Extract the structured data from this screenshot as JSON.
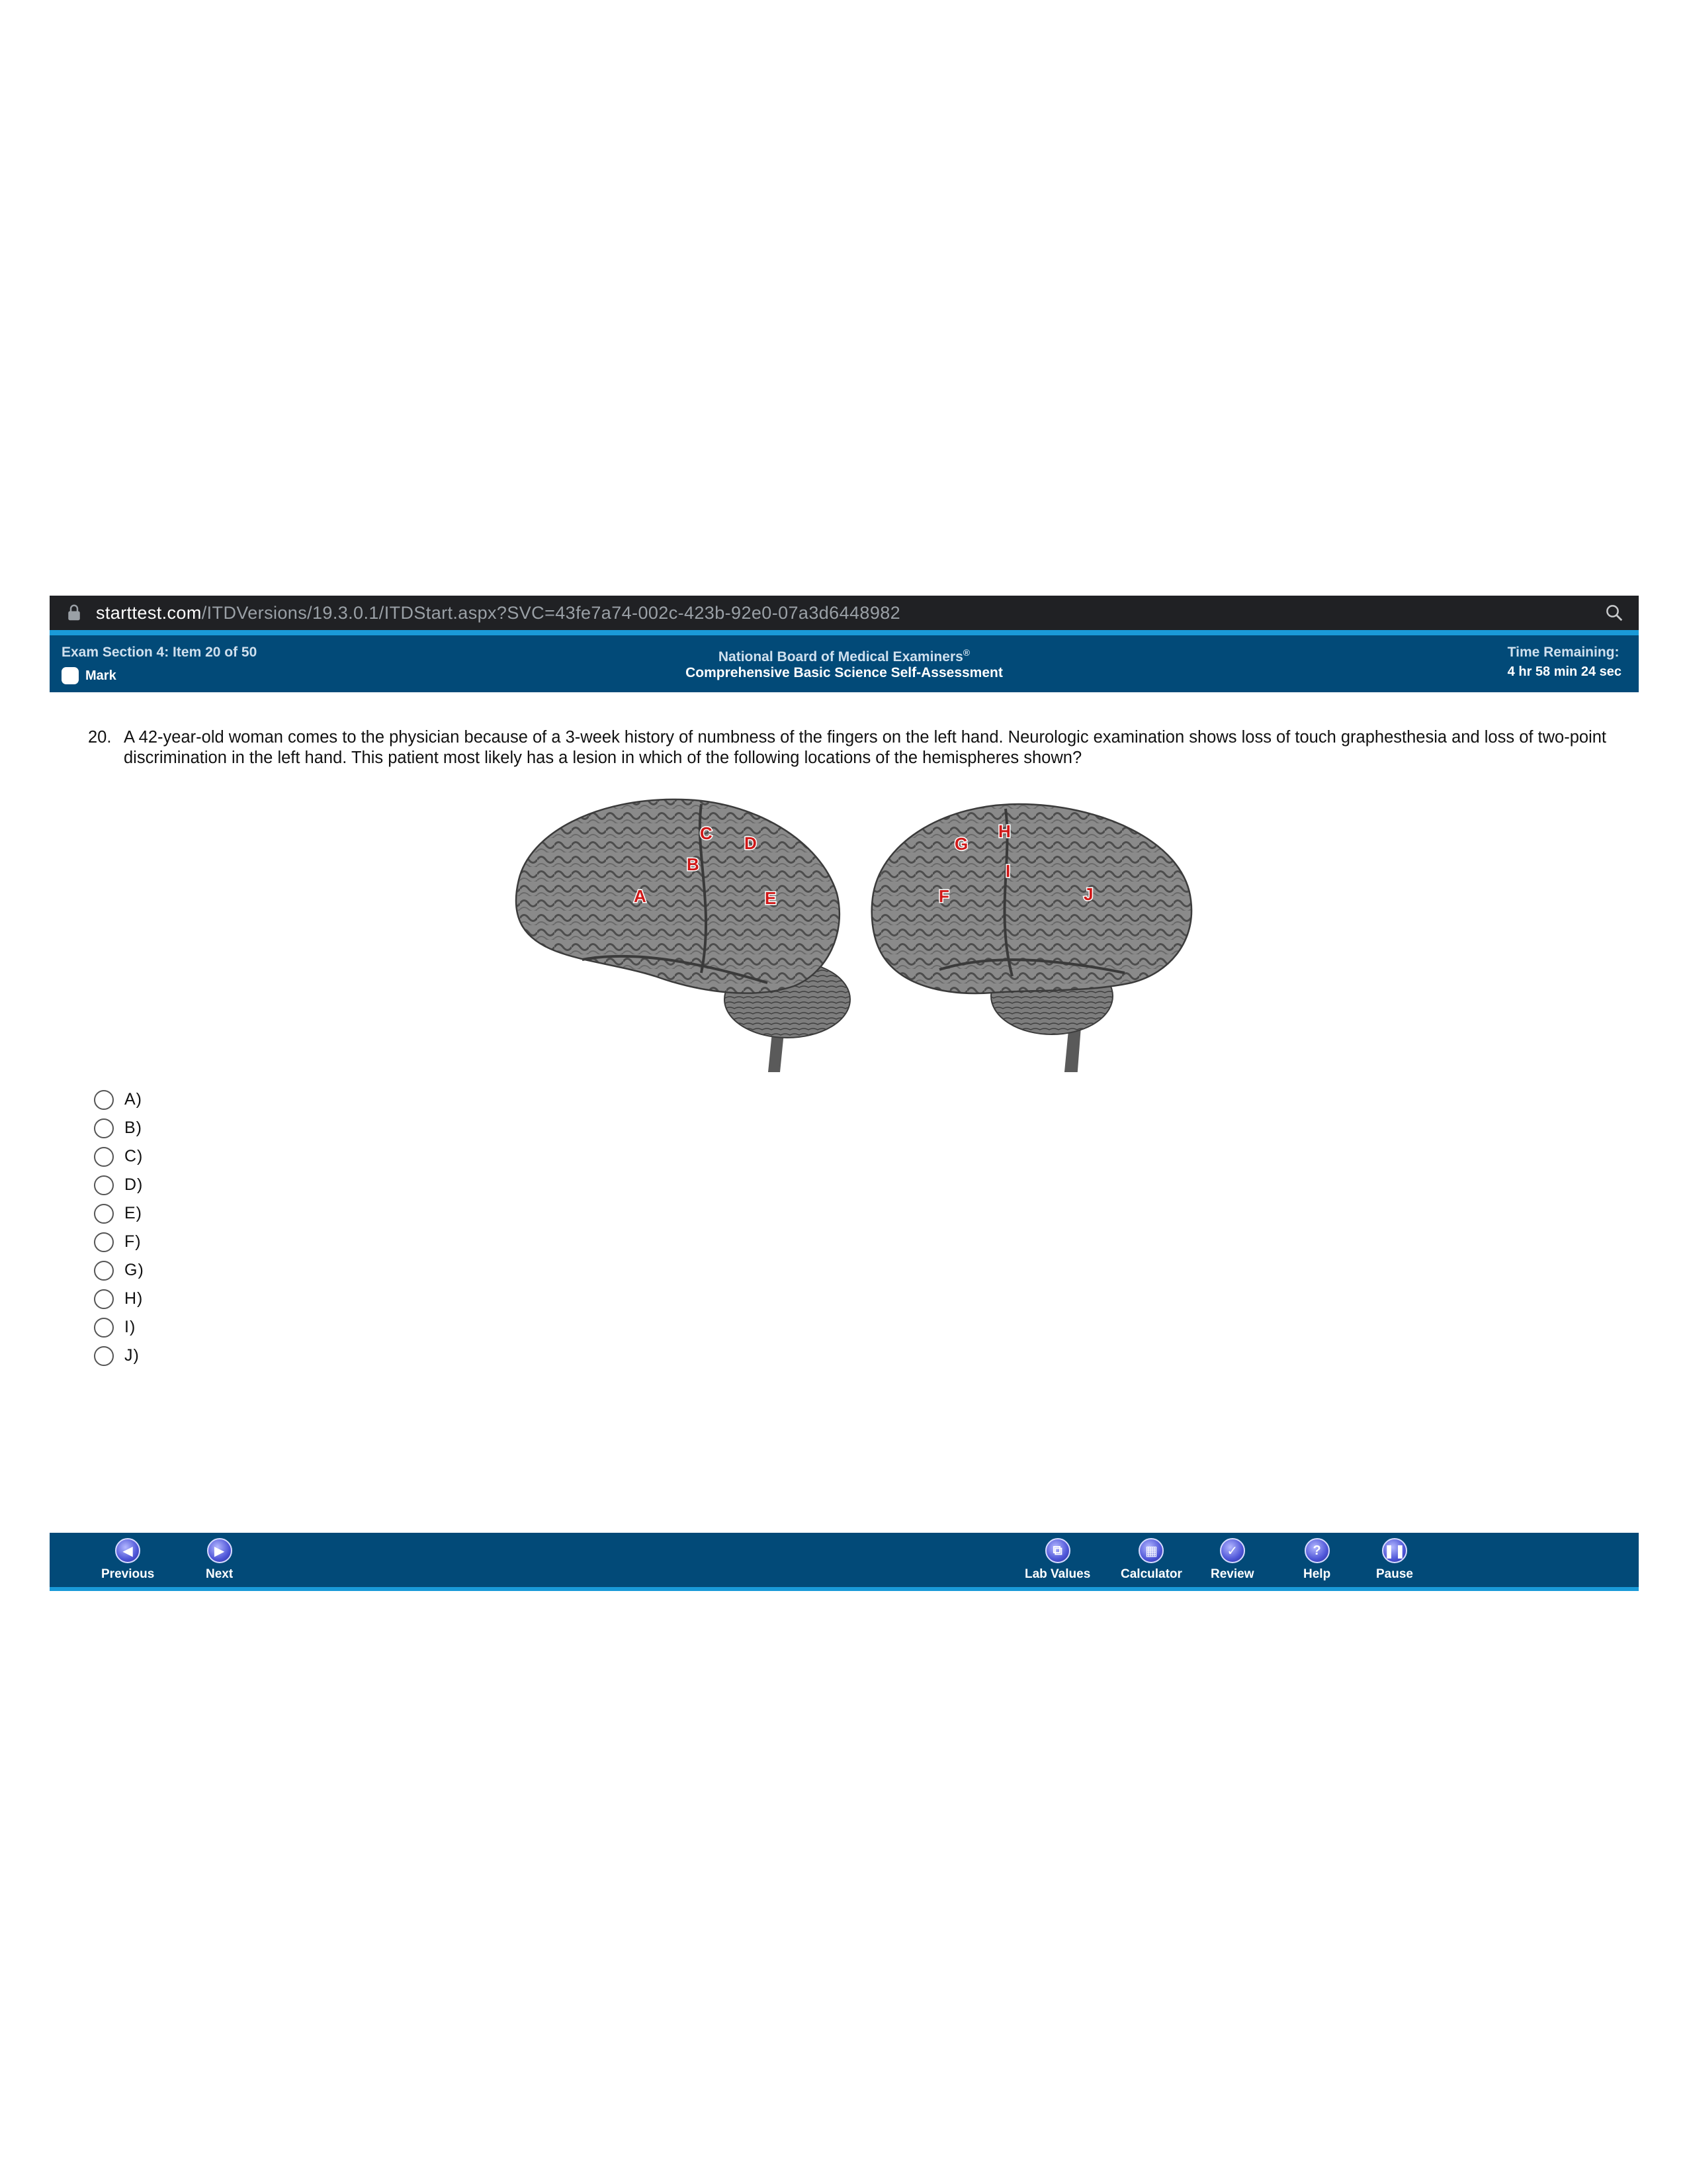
{
  "browser": {
    "url_host": "starttest.com",
    "url_path": "/ITDVersions/19.3.0.1/ITDStart.aspx?SVC=43fe7a74-002c-423b-92e0-07a3d6448982",
    "lock_icon": "lock-icon",
    "search_icon": "search-icon"
  },
  "header": {
    "section": "Exam Section 4: Item 20 of 50",
    "mark_label": "Mark",
    "org": "National Board of Medical Examiners",
    "org_mark": "®",
    "test_name": "Comprehensive Basic Science Self-Assessment",
    "time_label": "Time Remaining:",
    "time_value": "4 hr 58 min 24 sec"
  },
  "question": {
    "number": "20.",
    "stem": "A 42-year-old woman comes to the physician because of a 3-week history of numbness of the fingers on the left hand. Neurologic examination shows loss of touch graphesthesia and loss of two-point discrimination in the left hand. This patient most likely has a lesion in which of the following locations of the hemispheres shown?"
  },
  "figure": {
    "letters": [
      "A",
      "B",
      "C",
      "D",
      "E",
      "F",
      "G",
      "H",
      "I",
      "J"
    ],
    "label_color": "#d01818"
  },
  "answers": [
    "A)",
    "B)",
    "C)",
    "D)",
    "E)",
    "F)",
    "G)",
    "H)",
    "I)",
    "J)"
  ],
  "toolbar": {
    "previous": "Previous",
    "next": "Next",
    "lab_values": "Lab Values",
    "calculator": "Calculator",
    "review": "Review",
    "help": "Help",
    "pause": "Pause"
  },
  "colors": {
    "header_bg": "#024a78",
    "accent_line": "#1a9ad8",
    "url_bar_bg": "#202124"
  }
}
